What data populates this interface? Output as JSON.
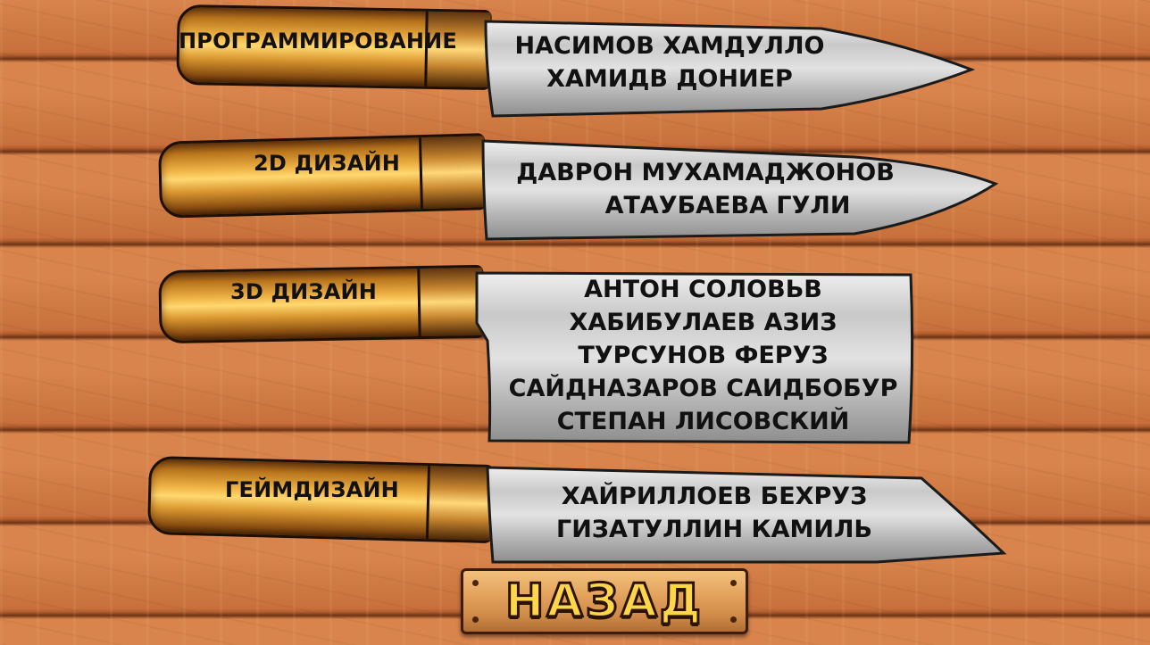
{
  "knives": [
    {
      "category": "ПРОГРАММИРОВАНИЕ",
      "names": [
        "НАСИМОВ ХАМДУЛЛО",
        "ХАМИДВ ДОНИЕР"
      ]
    },
    {
      "category": "2D ДИЗАЙН",
      "names": [
        "ДАВРОН МУХАМАДЖОНОВ",
        "АТАУБАЕВА ГУЛИ"
      ]
    },
    {
      "category": "3D ДИЗАЙН",
      "names": [
        "АНТОН СОЛОВЬВ",
        "ХАБИБУЛАЕВ АЗИЗ",
        "ТУРСУНОВ ФЕРУЗ",
        "САЙДНАЗАРОВ САИДБОБУР",
        "СТЕПАН ЛИСОВСКИЙ"
      ]
    },
    {
      "category": "ГЕЙМДИЗАЙН",
      "names": [
        "ХАЙРИЛЛОЕВ БЕХРУЗ",
        "ГИЗАТУЛЛИН КАМИЛЬ"
      ]
    }
  ],
  "back_button": {
    "label": "НАЗАД"
  }
}
